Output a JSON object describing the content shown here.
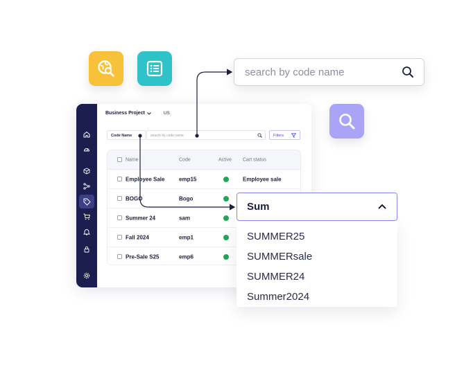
{
  "search": {
    "placeholder": "search by code name"
  },
  "app": {
    "project": "Business Project",
    "region": "US",
    "filter": {
      "code_label": "Code Name",
      "search_placeholder": "search by code name",
      "filters_label": "Filters"
    },
    "table": {
      "headers": {
        "name": "Name",
        "code": "Code",
        "active": "Active",
        "cart": "Cart status"
      },
      "rows": [
        {
          "name": "Employee Sale",
          "code": "emp15",
          "active": true,
          "cart": "Employee sale"
        },
        {
          "name": "BOGO",
          "code": "Bogo",
          "active": true,
          "cart": ""
        },
        {
          "name": "Summer 24",
          "code": "sam",
          "active": true,
          "cart": ""
        },
        {
          "name": "Fall 2024",
          "code": "emp1",
          "active": true,
          "cart": ""
        },
        {
          "name": "Pre-Sale S25",
          "code": "emp6",
          "active": true,
          "cart": ""
        }
      ]
    },
    "sidebar_icons": [
      "home-icon",
      "dashboard-icon",
      "box-icon",
      "network-icon",
      "tag-icon",
      "cart-icon",
      "bell-icon",
      "lock-icon",
      "settings-icon"
    ],
    "active_sidebar_item": "tag-icon"
  },
  "dropdown": {
    "value": "Sum",
    "options": [
      "SUMMER25",
      "SUMMERsale",
      "SUMMER24",
      "Summer2024"
    ]
  },
  "colors": {
    "sidebar": "#1c1e4f",
    "accent": "#8a86ef",
    "yellow_tile": "#f7c23a",
    "teal_tile": "#2fc3c9",
    "purple_tile": "#a9a4f6",
    "active_green": "#22a65a"
  },
  "tiles": [
    "search-globe-icon",
    "list-icon",
    "search-icon"
  ]
}
